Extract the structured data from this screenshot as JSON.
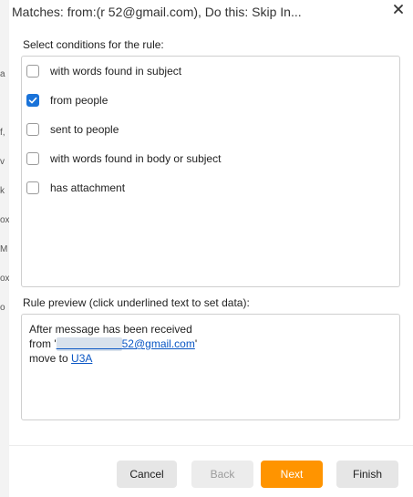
{
  "background_app": {
    "strip_glyphs": [
      "a",
      "f,",
      "v",
      "k",
      "ox",
      "M",
      "ox",
      "o"
    ]
  },
  "dialog": {
    "title": "Matches: from:(r           52@gmail.com), Do this: Skip In...",
    "close_icon": "close-icon",
    "conditions_label": "Select conditions for the rule:",
    "conditions": [
      {
        "label": "with words found in subject",
        "checked": false
      },
      {
        "label": "from people",
        "checked": true
      },
      {
        "label": "sent to people",
        "checked": false
      },
      {
        "label": "with words found in body or subject",
        "checked": false
      },
      {
        "label": "has attachment",
        "checked": false
      }
    ],
    "preview_label": "Rule preview (click underlined text to set data):",
    "preview": {
      "line1": "After message has been received",
      "line2_prefix": "from '",
      "email_visible": "52@gmail.com",
      "line2_suffix": "'",
      "line3_prefix": "move to ",
      "folder": "U3A"
    },
    "buttons": {
      "cancel": "Cancel",
      "back": "Back",
      "next": "Next",
      "finish": "Finish"
    }
  },
  "colors": {
    "accent": "#ff9400",
    "checkbox": "#1a73d9",
    "link": "#0b57c4"
  }
}
